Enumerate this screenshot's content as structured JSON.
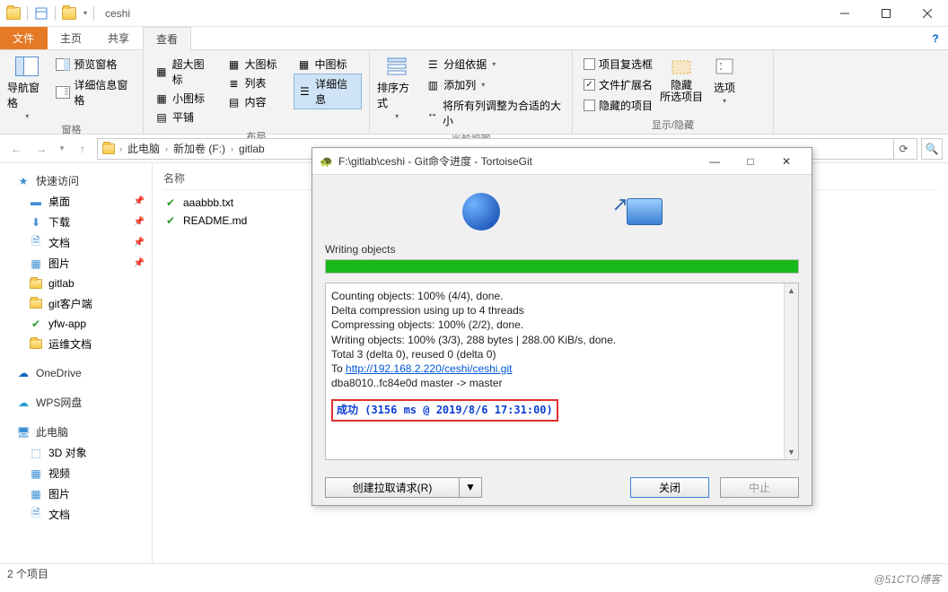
{
  "window": {
    "title": "ceshi"
  },
  "tabs": {
    "file": "文件",
    "home": "主页",
    "share": "共享",
    "view": "查看"
  },
  "ribbon": {
    "panes": {
      "lbl": "窗格",
      "nav": "导航窗格",
      "preview": "预览窗格",
      "details": "详细信息窗格"
    },
    "layout": {
      "lbl": "布局",
      "xl": "超大图标",
      "lg": "大图标",
      "md": "中图标",
      "sm": "小图标",
      "list": "列表",
      "detail": "详细信息",
      "tile": "平铺",
      "content": "内容"
    },
    "currentview": {
      "lbl": "当前视图",
      "sort": "排序方式",
      "group": "分组依据",
      "addcol": "添加列",
      "fit": "将所有列调整为合适的大小"
    },
    "showhide": {
      "lbl": "显示/隐藏",
      "chk1": "项目复选框",
      "chk2": "文件扩展名",
      "chk3": "隐藏的项目",
      "hide": "隐藏\n所选项目",
      "options": "选项"
    }
  },
  "breadcrumb": {
    "pc": "此电脑",
    "vol": "新加卷 (F:)",
    "gitlab": "gitlab"
  },
  "nav": {
    "quick": "快速访问",
    "desktop": "桌面",
    "downloads": "下载",
    "docs": "文档",
    "pics": "图片",
    "gitlab": "gitlab",
    "gitclient": "git客户端",
    "yfw": "yfw-app",
    "ops": "运维文档",
    "onedrive": "OneDrive",
    "wps": "WPS网盘",
    "thispc": "此电脑",
    "obj3d": "3D 对象",
    "videos": "视频",
    "pics2": "图片",
    "docs2": "文档"
  },
  "files": {
    "col_name": "名称",
    "f1": "aaabbb.txt",
    "f2": "README.md"
  },
  "status": {
    "count": "2 个项目"
  },
  "dialog": {
    "title": "F:\\gitlab\\ceshi - Git命令进度 - TortoiseGit",
    "stage": "Writing objects",
    "progress_pct": 100,
    "lines": {
      "l1": "Counting objects: 100% (4/4), done.",
      "l2": "Delta compression using up to 4 threads",
      "l3": "Compressing objects: 100% (2/2), done.",
      "l4": "Writing objects: 100% (3/3), 288 bytes | 288.00 KiB/s, done.",
      "l5": "Total 3 (delta 0), reused 0 (delta 0)",
      "l6_pre": "To ",
      "l6_url": "http://192.168.2.220/ceshi/ceshi.git",
      "l7": "dba8010..fc84e0d  master -> master"
    },
    "success": "成功 (3156 ms @ 2019/8/6 17:31:00)",
    "btn_pull": "创建拉取请求(R)",
    "btn_close": "关闭",
    "btn_abort": "中止"
  },
  "watermark": "@51CTO博客"
}
